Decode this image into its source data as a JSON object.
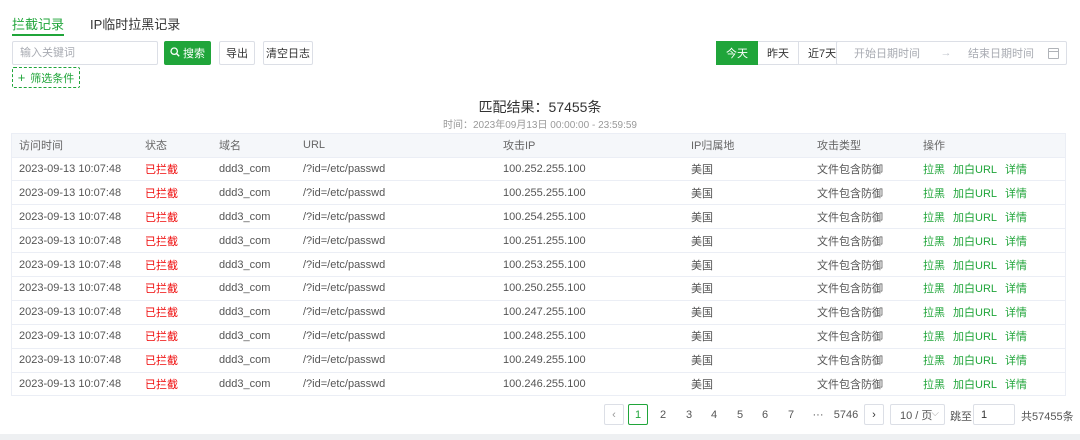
{
  "tabs": [
    {
      "label": "拦截记录",
      "active": true
    },
    {
      "label": "IP临时拉黑记录",
      "active": false
    }
  ],
  "toolbar": {
    "search_placeholder": "输入关键词",
    "search_label": "搜索",
    "export_label": "导出",
    "clear_log_label": "清空日志",
    "filter_label": "筛选条件"
  },
  "date_filter": {
    "buttons": [
      {
        "label": "今天",
        "active": true
      },
      {
        "label": "昨天",
        "active": false
      },
      {
        "label": "近7天",
        "active": false
      }
    ],
    "start_placeholder": "开始日期时间",
    "end_placeholder": "结束日期时间",
    "separator": "→"
  },
  "result": {
    "title": "匹配结果：57455条",
    "time_range": "时间：2023年09月13日 00:00:00 - 23:59:59"
  },
  "table": {
    "columns": [
      "访问时间",
      "状态",
      "域名",
      "URL",
      "攻击IP",
      "IP归属地",
      "攻击类型",
      "操作"
    ],
    "rows": [
      {
        "time": "2023-09-13 10:07:48",
        "status": "已拦截",
        "domain": "ddd3_com",
        "url": "/?id=/etc/passwd",
        "ip": "100.252.255.100",
        "location": "美国",
        "type": "文件包含防御"
      },
      {
        "time": "2023-09-13 10:07:48",
        "status": "已拦截",
        "domain": "ddd3_com",
        "url": "/?id=/etc/passwd",
        "ip": "100.255.255.100",
        "location": "美国",
        "type": "文件包含防御"
      },
      {
        "time": "2023-09-13 10:07:48",
        "status": "已拦截",
        "domain": "ddd3_com",
        "url": "/?id=/etc/passwd",
        "ip": "100.254.255.100",
        "location": "美国",
        "type": "文件包含防御"
      },
      {
        "time": "2023-09-13 10:07:48",
        "status": "已拦截",
        "domain": "ddd3_com",
        "url": "/?id=/etc/passwd",
        "ip": "100.251.255.100",
        "location": "美国",
        "type": "文件包含防御"
      },
      {
        "time": "2023-09-13 10:07:48",
        "status": "已拦截",
        "domain": "ddd3_com",
        "url": "/?id=/etc/passwd",
        "ip": "100.253.255.100",
        "location": "美国",
        "type": "文件包含防御"
      },
      {
        "time": "2023-09-13 10:07:48",
        "status": "已拦截",
        "domain": "ddd3_com",
        "url": "/?id=/etc/passwd",
        "ip": "100.250.255.100",
        "location": "美国",
        "type": "文件包含防御"
      },
      {
        "time": "2023-09-13 10:07:48",
        "status": "已拦截",
        "domain": "ddd3_com",
        "url": "/?id=/etc/passwd",
        "ip": "100.247.255.100",
        "location": "美国",
        "type": "文件包含防御"
      },
      {
        "time": "2023-09-13 10:07:48",
        "status": "已拦截",
        "domain": "ddd3_com",
        "url": "/?id=/etc/passwd",
        "ip": "100.248.255.100",
        "location": "美国",
        "type": "文件包含防御"
      },
      {
        "time": "2023-09-13 10:07:48",
        "status": "已拦截",
        "domain": "ddd3_com",
        "url": "/?id=/etc/passwd",
        "ip": "100.249.255.100",
        "location": "美国",
        "type": "文件包含防御"
      },
      {
        "time": "2023-09-13 10:07:48",
        "status": "已拦截",
        "domain": "ddd3_com",
        "url": "/?id=/etc/passwd",
        "ip": "100.246.255.100",
        "location": "美国",
        "type": "文件包含防御"
      }
    ],
    "actions": [
      "拉黑",
      "加白URL",
      "详情"
    ]
  },
  "pagination": {
    "prev": "‹",
    "next": "›",
    "pages": [
      "1",
      "2",
      "3",
      "4",
      "5",
      "6",
      "7",
      "···",
      "5746"
    ],
    "current": "1",
    "page_size": "10 / 页",
    "goto_label": "跳至",
    "goto_value": "1",
    "total": "共57455条"
  },
  "colors": {
    "accent": "#20a53a",
    "status_blocked": "#ef0808"
  }
}
